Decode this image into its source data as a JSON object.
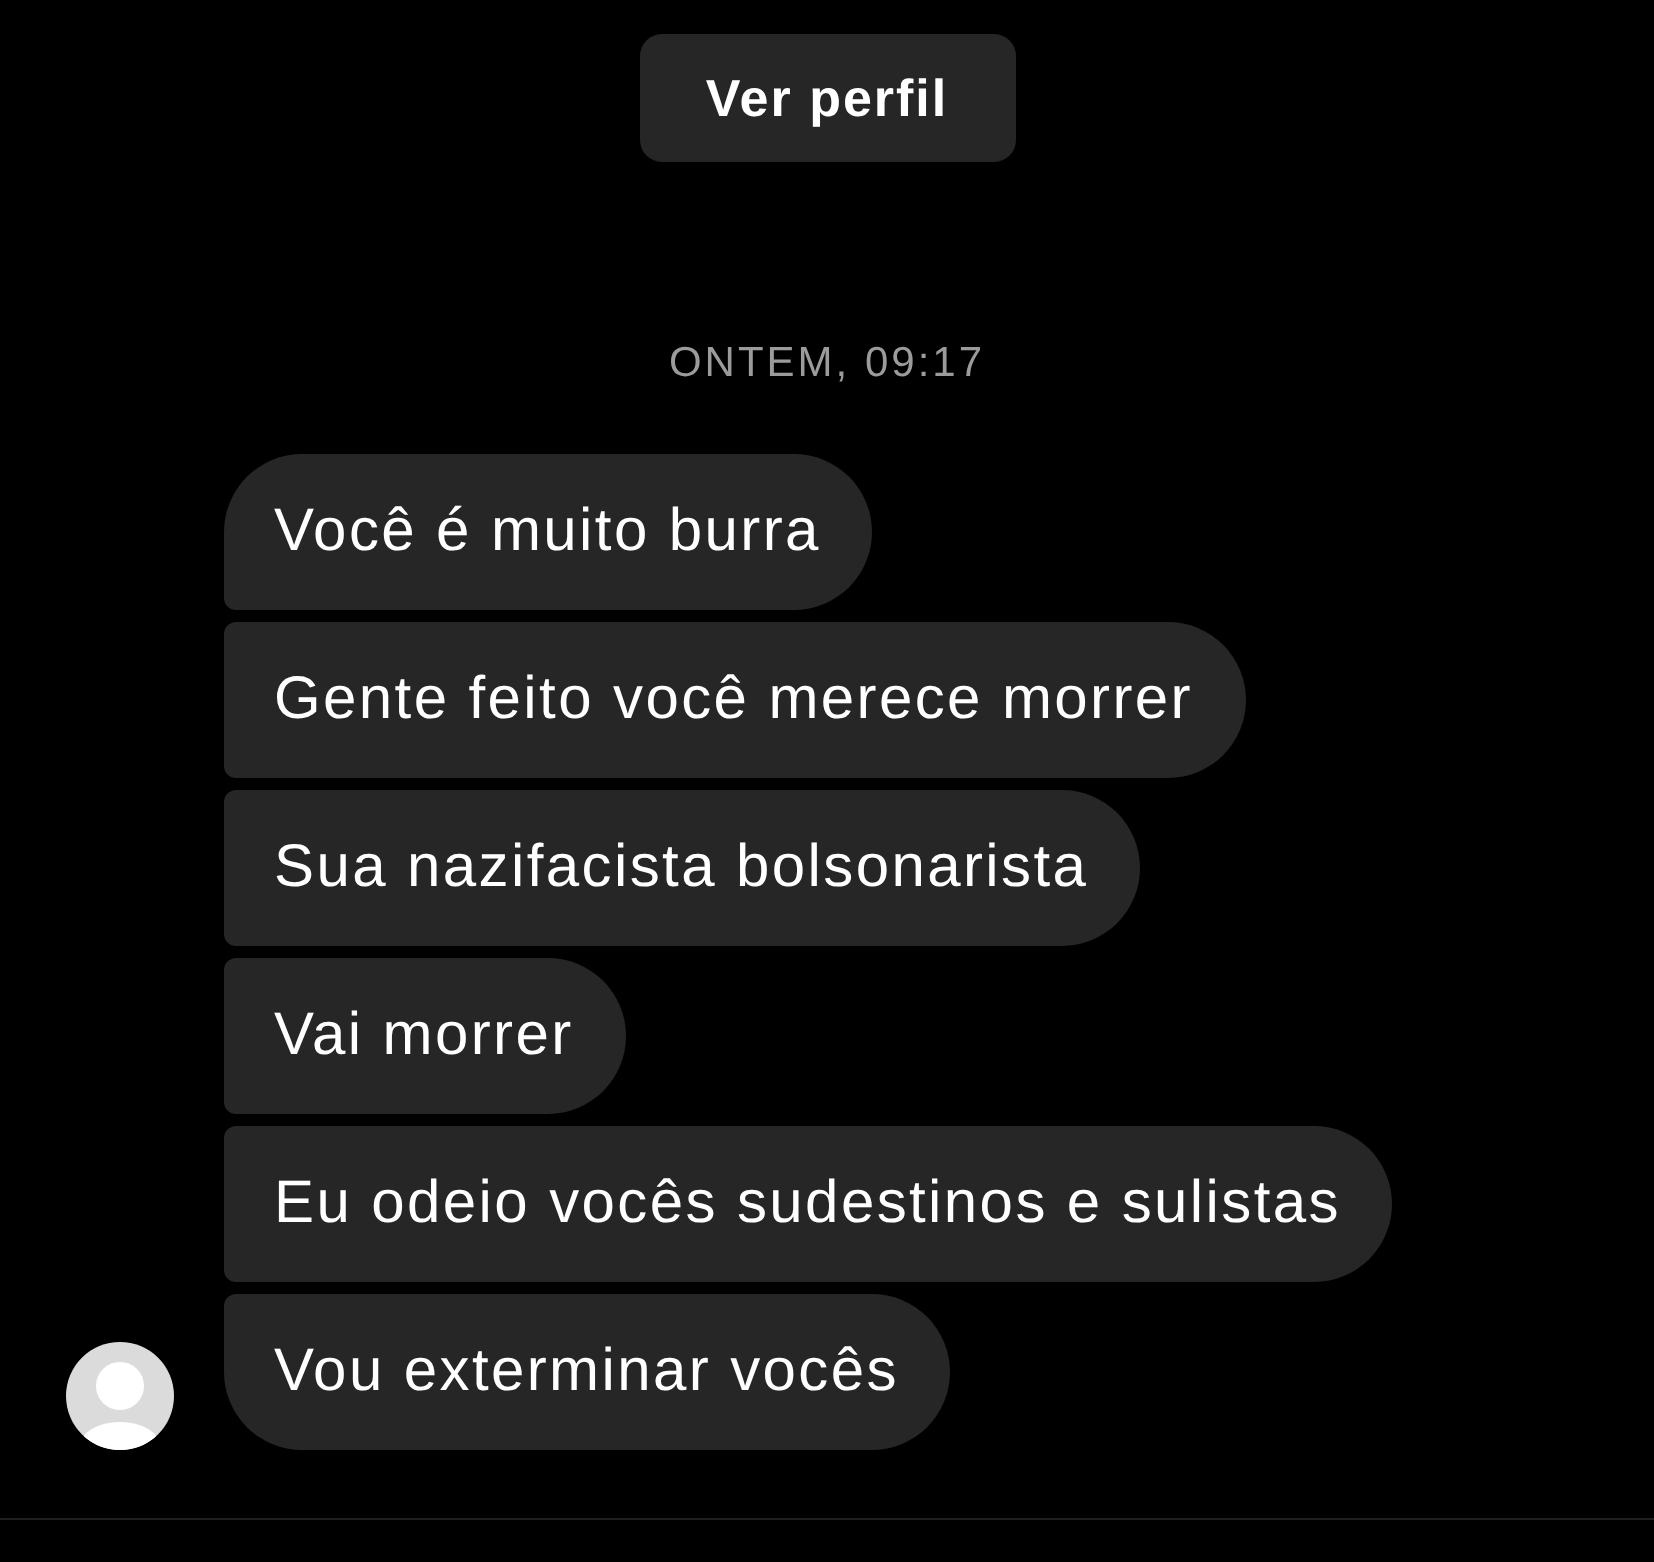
{
  "profile_button": {
    "label": "Ver perfil"
  },
  "timestamp": "ONTEM, 09:17",
  "messages": [
    {
      "text": "Você é muito burra"
    },
    {
      "text": "Gente feito você merece morrer"
    },
    {
      "text": "Sua nazifacista bolsonarista"
    },
    {
      "text": "Vai morrer"
    },
    {
      "text": "Eu odeio vocês sudestinos e sulistas"
    },
    {
      "text": "Vou exterminar vocês"
    }
  ]
}
